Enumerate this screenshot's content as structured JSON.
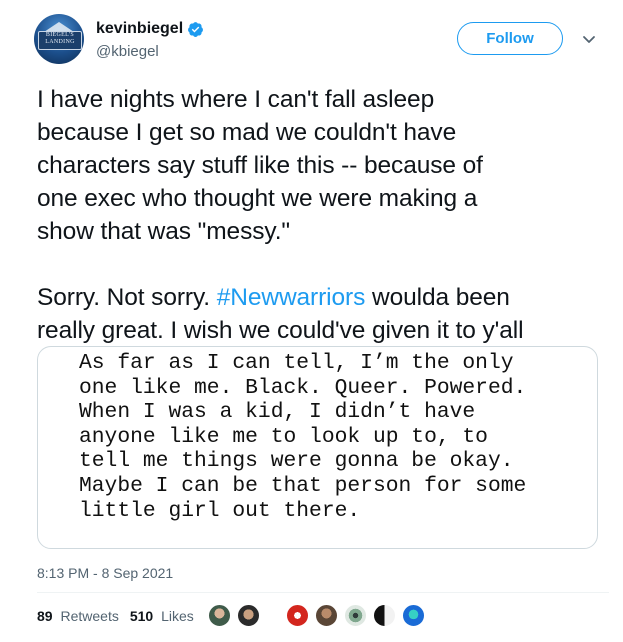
{
  "author": {
    "display_name": "kevinbiegel",
    "handle": "@kbiegel",
    "verified": true,
    "avatar_sign": "BIEGEL'S LANDING"
  },
  "follow_label": "Follow",
  "tweet": {
    "line1": "I have nights where I can't fall asleep",
    "line2": "because I get so mad we couldn't have",
    "line3": "characters say stuff like this -- because of",
    "line4": "one exec who thought we were making a",
    "line5": "show that was \"messy.\"",
    "line6_pre": "Sorry. Not sorry. ",
    "hashtag": "#Newwarriors",
    "line6_post": " woulda been",
    "line7": "really great. I wish we could've given it to y'all"
  },
  "media_text": {
    "l1": "As far as I can tell, I’m the only",
    "l2": "one like me. Black. Queer. Powered.",
    "l3": "When I was a kid, I didn’t have",
    "l4": "anyone like me to look up to, to",
    "l5": "tell me things were gonna be okay.",
    "l6": "Maybe I can be that person for some",
    "l7": "little girl out there."
  },
  "timestamp": "8:13 PM - 8 Sep 2021",
  "stats": {
    "retweets_count": "89",
    "retweets_label": "Retweets",
    "likes_count": "510",
    "likes_label": "Likes"
  },
  "colors": {
    "accent": "#1d9bf0",
    "text": "#0f1419",
    "muted": "#536471"
  },
  "icons": {
    "verified": "verified-badge-icon",
    "chevron": "chevron-down-icon"
  }
}
